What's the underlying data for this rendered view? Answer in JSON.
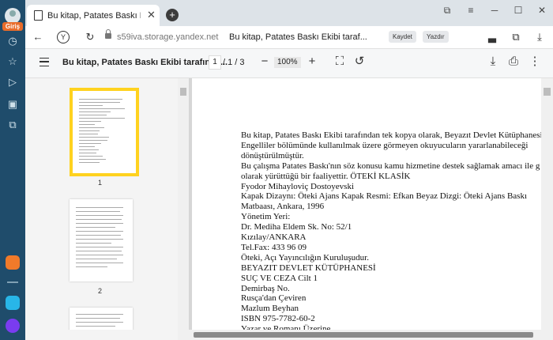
{
  "sidebar": {
    "login_label": "Giriş"
  },
  "tab": {
    "title": "Bu kitap, Patates Baskı Ekibi"
  },
  "address": {
    "host": "s59iva.storage.yandex.net",
    "page_title": "Bu kitap, Patates Baskı Ekibi taraf...",
    "save_label": "Kaydet",
    "print_label": "Yazdır"
  },
  "pdf": {
    "doc_title": "Bu kitap, Patates Baskı Ekibi tarafında...",
    "page_current": "1",
    "page_total": "/ 1 / 3",
    "zoom": "100%"
  },
  "thumbnails": [
    {
      "number": "1"
    },
    {
      "number": "2"
    }
  ],
  "page_lines": [
    "Bu kitap, Patates Baskı Ekibi tarafından tek kopya olarak, Beyazıt Devlet Kütüphanesi",
    "Engelliler bölümünde kullanılmak üzere görmeyen okuyucuların yararlanabileceği",
    "dönüştürülmüştür.",
    "Bu çalışma Patates Baskı'nın söz konusu kamu hizmetine destek sağlamak amacı ile g",
    "olarak yürüttüğü bir faaliyettir. ÖTEKİ KLASİK",
    "Fyodor Mihayloviç Dostoyevski",
    "Kapak Dizaynı: Öteki Ajans Kapak Resmi: Efkan Beyaz Dizgi: Öteki Ajans Baskı",
    "Matbaası, Ankara, 1996",
    "Yönetim Yeri:",
    "Dr. Mediha Eldem Sk. No: 52/1",
    "Kızılay/ANKARA",
    "Tel.Fax: 433 96 09",
    "Öteki, Açı Yayıncılığın Kuruluşudur.",
    "BEYAZIT DEVLET  KÜTÜPHANESİ",
    "SUÇ VE CEZA Cilt 1",
    "Demirbaş No.",
    "Rusça'dan Çeviren",
    "Mazlum Beyhan",
    "ISBN 975-7782-60-2",
    "Yazar ve Romanı Üzerine"
  ]
}
